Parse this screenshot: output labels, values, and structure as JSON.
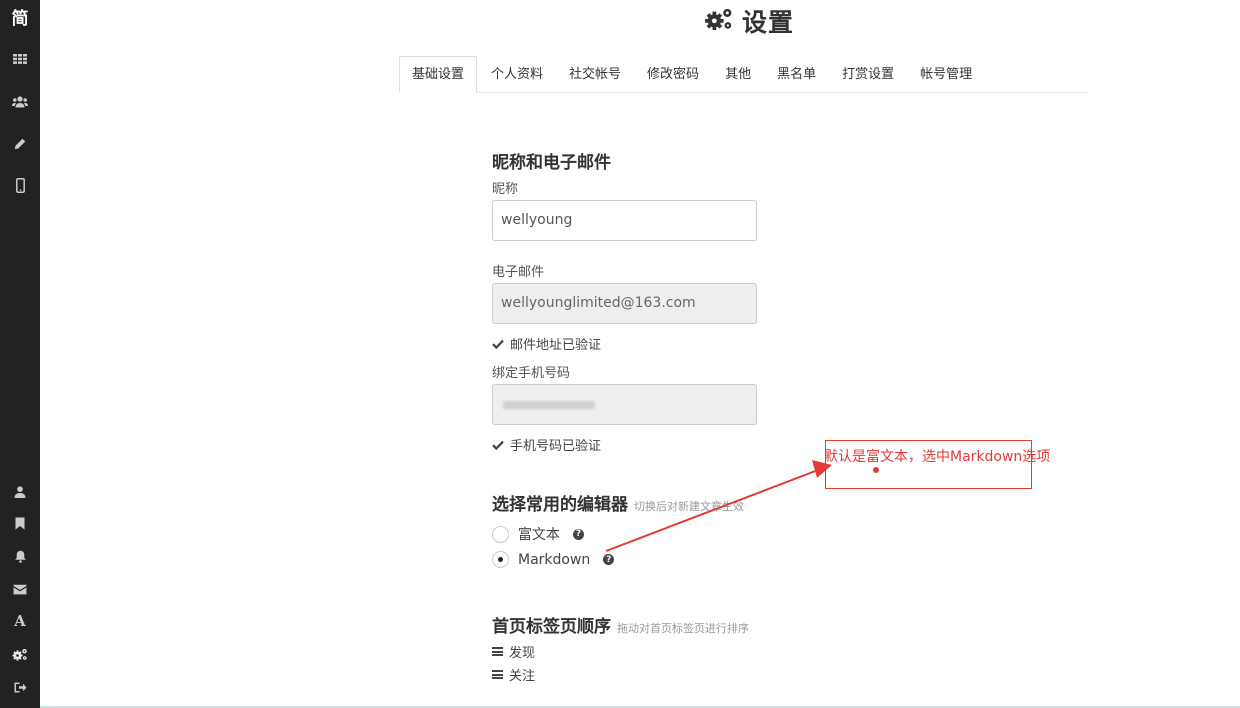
{
  "sidebar": {
    "logo": "简",
    "items_top": [
      {
        "name": "grid-icon"
      },
      {
        "name": "users-icon"
      },
      {
        "name": "pencil-icon"
      },
      {
        "name": "mobile-icon"
      }
    ],
    "items_bottom": [
      {
        "name": "user-icon"
      },
      {
        "name": "bookmark-icon"
      },
      {
        "name": "bell-icon"
      },
      {
        "name": "envelope-icon"
      },
      {
        "name": "font-icon",
        "glyph": "A"
      },
      {
        "name": "gears-icon"
      },
      {
        "name": "sign-out-icon"
      }
    ]
  },
  "page": {
    "title": "设置"
  },
  "tabs": [
    {
      "label": "基础设置",
      "active": true
    },
    {
      "label": "个人资料"
    },
    {
      "label": "社交帐号"
    },
    {
      "label": "修改密码"
    },
    {
      "label": "其他"
    },
    {
      "label": "黑名单"
    },
    {
      "label": "打赏设置"
    },
    {
      "label": "帐号管理"
    }
  ],
  "profile": {
    "section_title": "昵称和电子邮件",
    "nickname_label": "昵称",
    "nickname_value": "wellyoung",
    "email_label": "电子邮件",
    "email_value": "wellyounglimited@163.com",
    "email_verified": "邮件地址已验证",
    "phone_label": "绑定手机号码",
    "phone_verified": "手机号码已验证"
  },
  "editor": {
    "section_title": "选择常用的编辑器",
    "hint": "切换后对新建文章生效",
    "options": [
      {
        "label": "富文本",
        "checked": false
      },
      {
        "label": "Markdown",
        "checked": true
      }
    ]
  },
  "tab_order": {
    "section_title": "首页标签页顺序",
    "hint": "拖动对首页标签页进行排序",
    "items": [
      "发现",
      "关注"
    ]
  },
  "annotation": {
    "text": "默认是富文本，选中Markdown选项",
    "color": "#e53935"
  }
}
